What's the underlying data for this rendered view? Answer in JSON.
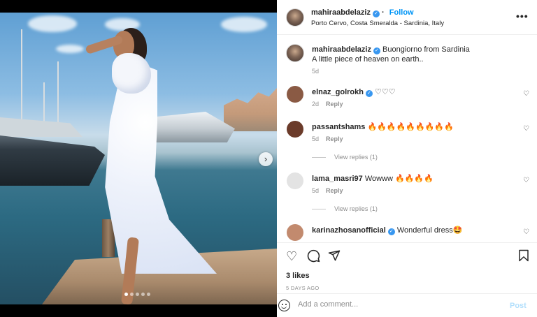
{
  "post": {
    "author": "mahiraabdelaziz",
    "follow_label": "Follow",
    "location": "Porto Cervo, Costa Smeralda - Sardinia, Italy",
    "more_icon": "more-horizontal-icon"
  },
  "caption": {
    "author": "mahiraabdelaziz",
    "line1": "Buongiorno from Sardinia",
    "line2": "A little piece of heaven on earth..",
    "age": "5d"
  },
  "comments": [
    {
      "user": "elnaz_golrokh",
      "verified": true,
      "text": "♡♡♡",
      "age": "2d",
      "reply_label": "Reply",
      "avatar_color": "#8a5a44"
    },
    {
      "user": "passantshams",
      "verified": false,
      "text": "🔥🔥🔥🔥🔥🔥🔥🔥🔥",
      "age": "5d",
      "reply_label": "Reply",
      "view_replies": "View replies (1)",
      "avatar_color": "#6b3b2a"
    },
    {
      "user": "lama_masri97",
      "verified": false,
      "text": "Wowww 🔥🔥🔥🔥",
      "age": "5d",
      "reply_label": "Reply",
      "view_replies": "View replies (1)",
      "avatar_color": "#dbdbdb"
    },
    {
      "user": "karinazhosanofficial",
      "verified": true,
      "text": "Wonderful dress🤩",
      "avatar_color": "#c28a6e"
    }
  ],
  "stats": {
    "likes": "3 likes",
    "date": "5 DAYS AGO"
  },
  "composer": {
    "placeholder": "Add a comment...",
    "post_label": "Post"
  },
  "media": {
    "next_icon": "›"
  },
  "colors": {
    "accent": "#0095f6",
    "verified": "#3897f0",
    "muted": "#8e8e8e"
  }
}
